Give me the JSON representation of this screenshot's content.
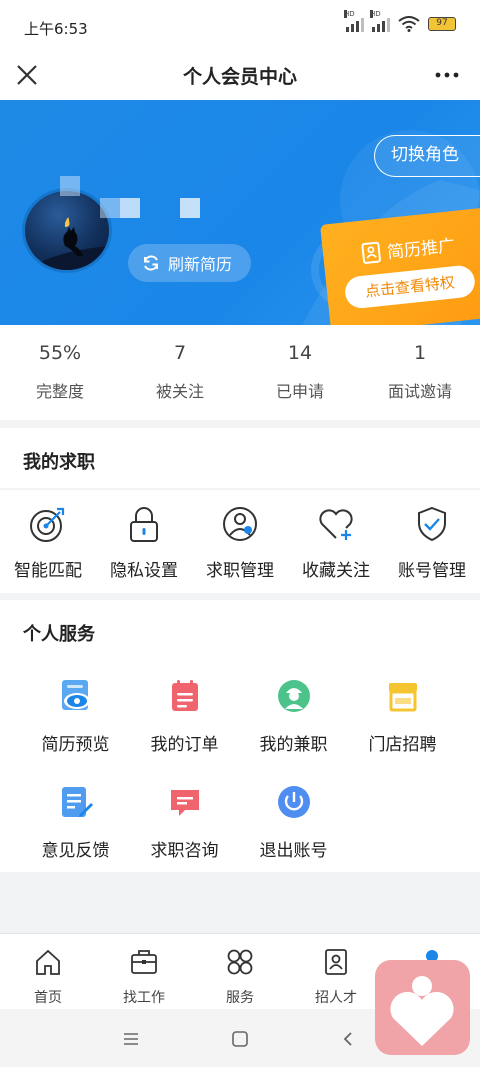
{
  "status": {
    "time": "上午6:53",
    "battery": "97",
    "hd_label": "HD"
  },
  "header": {
    "title": "个人会员中心"
  },
  "hero": {
    "switch_role": "切换角色",
    "refresh": "刷新简历",
    "promo_title": "简历推广",
    "promo_sub": "点击查看特权"
  },
  "stats": [
    {
      "value": "55%",
      "label": "完整度"
    },
    {
      "value": "7",
      "label": "被关注"
    },
    {
      "value": "14",
      "label": "已申请"
    },
    {
      "value": "1",
      "label": "面试邀请"
    }
  ],
  "job": {
    "heading": "我的求职",
    "items": [
      {
        "label": "智能匹配",
        "icon": "target-icon"
      },
      {
        "label": "隐私设置",
        "icon": "lock-icon"
      },
      {
        "label": "求职管理",
        "icon": "user-gear-icon"
      },
      {
        "label": "收藏关注",
        "icon": "heart-plus-icon"
      },
      {
        "label": "账号管理",
        "icon": "shield-check-icon"
      }
    ]
  },
  "services": {
    "heading": "个人服务",
    "items": [
      {
        "label": "简历预览",
        "icon": "resume-eye-icon"
      },
      {
        "label": "我的订单",
        "icon": "order-icon"
      },
      {
        "label": "我的兼职",
        "icon": "worker-icon"
      },
      {
        "label": "门店招聘",
        "icon": "store-icon"
      },
      {
        "label": "意见反馈",
        "icon": "feedback-icon"
      },
      {
        "label": "求职咨询",
        "icon": "chat-icon"
      },
      {
        "label": "退出账号",
        "icon": "power-icon"
      }
    ]
  },
  "tabs": [
    {
      "label": "首页",
      "icon": "home-icon"
    },
    {
      "label": "找工作",
      "icon": "briefcase-icon"
    },
    {
      "label": "服务",
      "icon": "grid-icon"
    },
    {
      "label": "招人才",
      "icon": "recruit-icon"
    }
  ],
  "colors": {
    "primary": "#1a86e8",
    "promo": "#ffa415",
    "accent_red": "#f0646e",
    "accent_yellow": "#f5c431"
  }
}
